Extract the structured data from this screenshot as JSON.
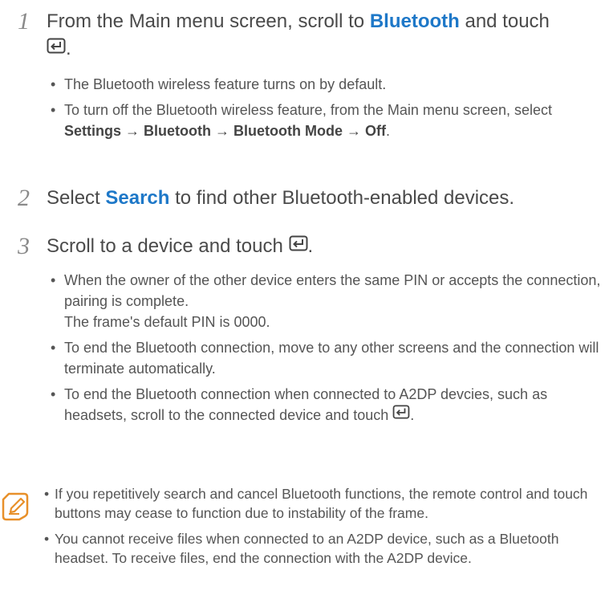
{
  "step1": {
    "num": "1",
    "t1": "From the Main menu screen, scroll to ",
    "hl": "Bluetooth",
    "t2": " and touch",
    "t3": ".",
    "bullets": [
      {
        "text": "The Bluetooth wireless feature turns on by default."
      },
      {
        "pre": "To turn off the Bluetooth wireless feature, from the Main menu screen, select ",
        "path": "Settings → Bluetooth → Bluetooth Mode → Off",
        "post": "."
      }
    ]
  },
  "step2": {
    "num": "2",
    "t1": "Select ",
    "hl": "Search",
    "t2": " to find other Bluetooth-enabled devices."
  },
  "step3": {
    "num": "3",
    "t1": "Scroll to a device and touch ",
    "t2": ".",
    "bullets": [
      {
        "text": "When the owner of the other device enters the same PIN or accepts the connection, pairing is complete.",
        "sub": "The frame's default PIN is 0000."
      },
      {
        "text": "To end the Bluetooth connection, move to any other screens and the connection will terminate automatically."
      },
      {
        "pre": "To end the Bluetooth connection when connected to A2DP devcies, such as headsets, scroll to the connected device and touch ",
        "post": "."
      }
    ]
  },
  "notes": [
    "If you repetitively search and cancel Bluetooth functions, the remote control and touch buttons may cease to function due to instability of the frame.",
    "You cannot receive files when connected to  an A2DP device, such as a Bluetooth headset. To receive files, end the connection with the A2DP device."
  ],
  "icons": {
    "enter": "enter-key-icon",
    "note": "note-pencil-icon"
  },
  "colors": {
    "highlight": "#1e78c8",
    "note_icon": "#e8902a",
    "text": "#555555"
  }
}
